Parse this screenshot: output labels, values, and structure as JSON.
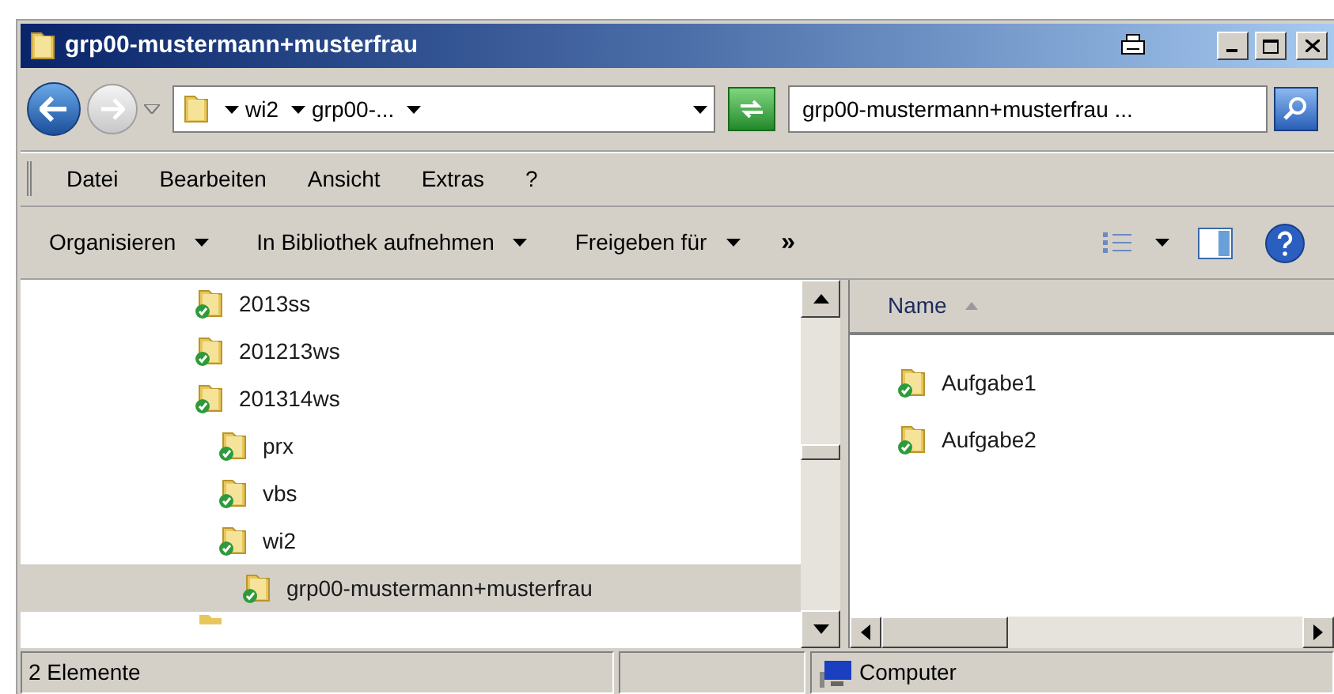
{
  "window": {
    "title": "grp00-mustermann+musterfrau"
  },
  "address": {
    "crumbs": [
      "wi2",
      "grp00-..."
    ],
    "search_value": "grp00-mustermann+musterfrau ..."
  },
  "menu": [
    "Datei",
    "Bearbeiten",
    "Ansicht",
    "Extras",
    "?"
  ],
  "commands": [
    "Organisieren",
    "In Bibliothek aufnehmen",
    "Freigeben für"
  ],
  "more": "»",
  "tree": [
    {
      "label": "2013ss",
      "selected": false
    },
    {
      "label": "201213ws",
      "selected": false
    },
    {
      "label": "201314ws",
      "selected": false,
      "children": [
        {
          "label": "prx",
          "selected": false
        },
        {
          "label": "vbs",
          "selected": false
        },
        {
          "label": "wi2",
          "selected": false,
          "children": [
            {
              "label": "grp00-mustermann+musterfrau",
              "selected": true
            }
          ]
        }
      ]
    }
  ],
  "list": {
    "column": "Name",
    "items": [
      "Aufgabe1",
      "Aufgabe2"
    ]
  },
  "status_bar": {
    "count": "2 Elemente",
    "location": "Computer"
  }
}
